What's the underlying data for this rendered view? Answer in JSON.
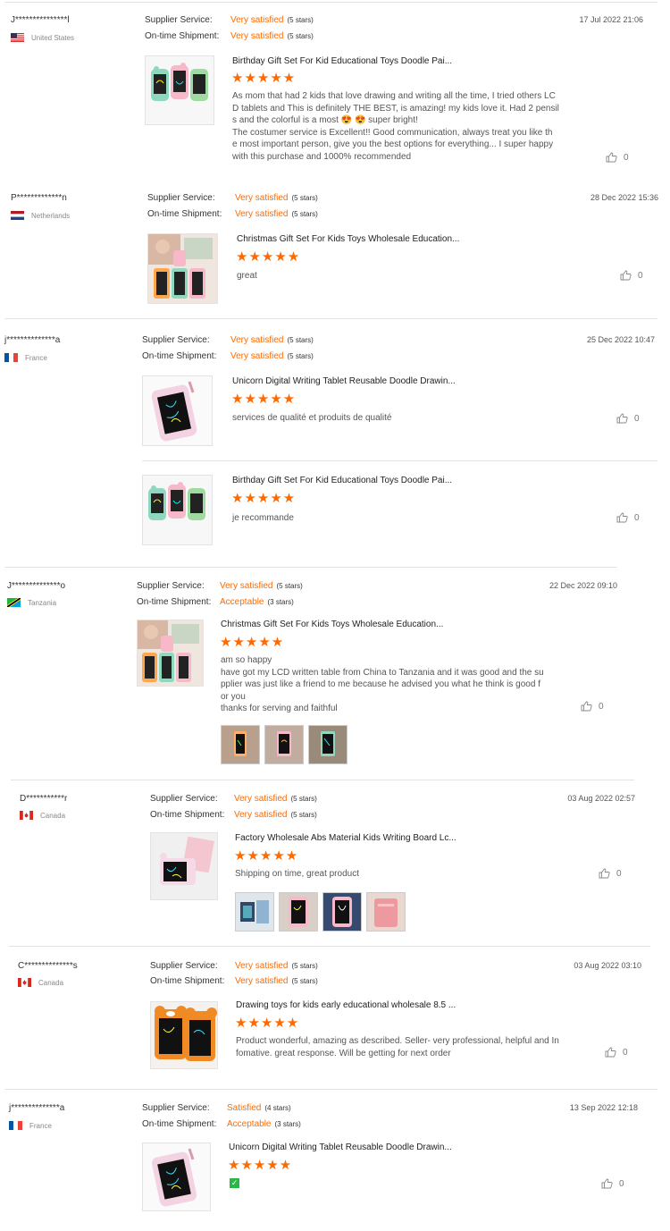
{
  "labels": {
    "supplier": "Supplier Service:",
    "shipment": "On-time Shipment:"
  },
  "colors": {
    "accent": "#ff6a00",
    "separator": "#e3e3e3"
  },
  "reviews": [
    {
      "name": "J***************l",
      "country": "United States",
      "flag": "us",
      "supplier": "Very satisfied",
      "supplier_stars": "(5 stars)",
      "shipment": "Very satisfied",
      "shipment_stars": "(5 stars)",
      "date": "17 Jul 2022 21:06",
      "products": [
        {
          "title": "Birthday Gift Set For Kid Educational Toys Doodle Pai...",
          "stars": "★★★★★",
          "text": "As mom that had 2 kids that love drawing and writing all the time, I tried others LC\nD tablets and This is definitely THE BEST, is amazing! my kids love it. Had 2 pensil\ns and the colorful is a most 😍 😍 super bright!\nThe costumer service is Excellent!! Good communication, always treat you like th\ne most important person, give you the best options for everything... I super happy\nwith this purchase and 1000% recommended",
          "likes": "0",
          "thumb": "frogs"
        }
      ]
    },
    {
      "name": "P*************n",
      "country": "Netherlands",
      "flag": "nl",
      "supplier": "Very satisfied",
      "supplier_stars": "(5 stars)",
      "shipment": "Very satisfied",
      "shipment_stars": "(5 stars)",
      "date": "28 Dec 2022 15:36",
      "products": [
        {
          "title": "Christmas Gift Set For Kids Toys Wholesale Education...",
          "stars": "★★★★★",
          "text": "great",
          "likes": "0",
          "thumb": "photo"
        }
      ]
    },
    {
      "name": "j**************a",
      "country": "France",
      "flag": "fr",
      "supplier": "Very satisfied",
      "supplier_stars": "(5 stars)",
      "shipment": "Very satisfied",
      "shipment_stars": "(5 stars)",
      "date": "25 Dec 2022 10:47",
      "products": [
        {
          "title": "Unicorn Digital Writing Tablet Reusable Doodle Drawin...",
          "stars": "★★★★★",
          "text": "services de qualité et produits de qualité",
          "likes": "0",
          "thumb": "unicorn"
        },
        {
          "title": "Birthday Gift Set For Kid Educational Toys Doodle Pai...",
          "stars": "★★★★★",
          "text": "je recommande",
          "likes": "0",
          "thumb": "frogs"
        }
      ]
    },
    {
      "name": "J**************o",
      "country": "Tanzania",
      "flag": "tz",
      "supplier": "Very satisfied",
      "supplier_stars": "(5 stars)",
      "shipment": "Acceptable",
      "shipment_stars": "(3 stars)",
      "date": "22 Dec 2022 09:10",
      "products": [
        {
          "title": "Christmas Gift Set For Kids Toys Wholesale Education...",
          "stars": "★★★★★",
          "text": "am so happy\nhave got my LCD written table from China to Tanzania and it was good and the su\npplier was just like a friend to me because he advised you what he think is good f\nor you\nthanks for serving and faithful",
          "likes": "0",
          "thumb": "photo"
        }
      ]
    },
    {
      "name": "D***********r",
      "country": "Canada",
      "flag": "ca",
      "supplier": "Very satisfied",
      "supplier_stars": "(5 stars)",
      "shipment": "Very satisfied",
      "shipment_stars": "(5 stars)",
      "date": "03 Aug 2022 02:57",
      "products": [
        {
          "title": "Factory Wholesale Abs Material Kids Writing Board Lc...",
          "stars": "★★★★★",
          "text": "Shipping on time, great product",
          "likes": "0",
          "thumb": "pinkboard"
        }
      ]
    },
    {
      "name": "C**************s",
      "country": "Canada",
      "flag": "ca",
      "supplier": "Very satisfied",
      "supplier_stars": "(5 stars)",
      "shipment": "Very satisfied",
      "shipment_stars": "(5 stars)",
      "date": "03 Aug 2022 03:10",
      "products": [
        {
          "title": "Drawing toys for kids early educational wholesale 8.5 ...",
          "stars": "★★★★★",
          "text": "Product wonderful, amazing as described. Seller- very professional, helpful and In\nfomative. great response. Will be getting for next order",
          "likes": "0",
          "thumb": "bear"
        }
      ]
    },
    {
      "name": "j**************a",
      "country": "France",
      "flag": "fr",
      "supplier": "Satisfied",
      "supplier_stars": "(4 stars)",
      "shipment": "Acceptable",
      "shipment_stars": "(3 stars)",
      "date": "13 Sep 2022 12:18",
      "products": [
        {
          "title": "Unicorn Digital Writing Tablet Reusable Doodle Drawin...",
          "stars": "★★★★★",
          "text": "",
          "likes": "0",
          "thumb": "unicorn"
        }
      ]
    }
  ]
}
